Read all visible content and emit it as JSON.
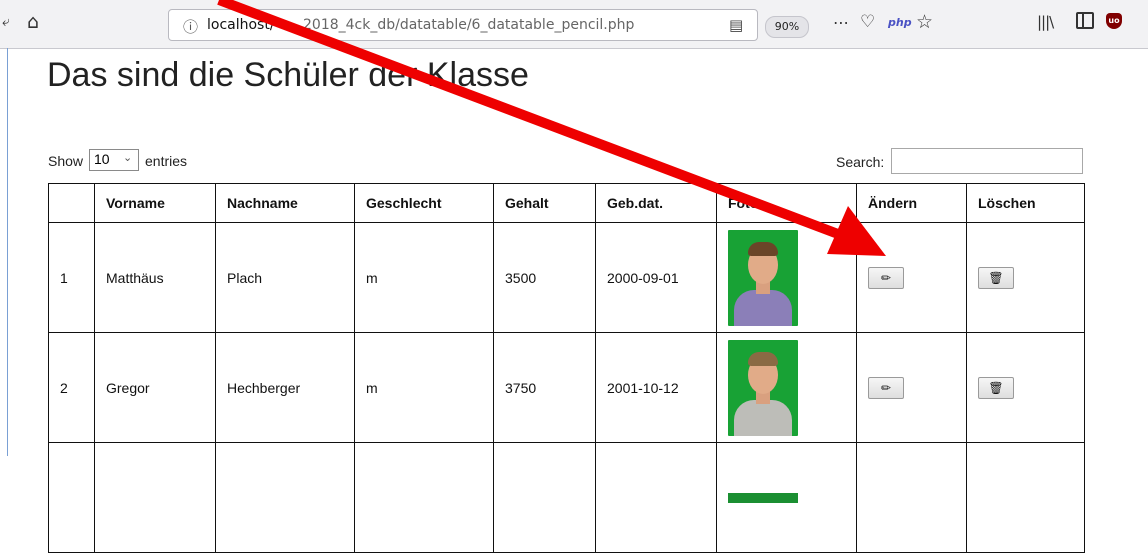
{
  "browser": {
    "url_host": "localhost/",
    "url_path": "2018_4ck_db/datatable/6_datatable_pencil.php",
    "zoom": "90%",
    "php_badge": "php",
    "ublock_badge": "uo",
    "icons": [
      "back-icon",
      "home-icon",
      "info-icon",
      "reader-view-icon",
      "more-icon",
      "pocket-icon",
      "php-icon",
      "bookmark-star-icon",
      "library-icon",
      "sidebar-icon",
      "ublock-icon"
    ]
  },
  "page": {
    "title": "Das sind die Schüler der Klasse",
    "show_label": "Show",
    "entries_label": "entries",
    "page_length": "10",
    "search_label": "Search:",
    "search_value": ""
  },
  "table": {
    "headers": [
      "",
      "Vorname",
      "Nachname",
      "Geschlecht",
      "Gehalt",
      "Geb.dat.",
      "Foto",
      "Ändern",
      "Löschen"
    ],
    "rows": [
      {
        "nr": "1",
        "vorname": "Matthäus",
        "nachname": "Plach",
        "geschlecht": "m",
        "gehalt": "3500",
        "gebdat": "2000-09-01"
      },
      {
        "nr": "2",
        "vorname": "Gregor",
        "nachname": "Hechberger",
        "geschlecht": "m",
        "gehalt": "3750",
        "gebdat": "2001-10-12"
      }
    ],
    "edit_icon": "✏",
    "delete_icon": "🗑"
  },
  "annotation": {
    "arrow_color": "#ee0000"
  }
}
